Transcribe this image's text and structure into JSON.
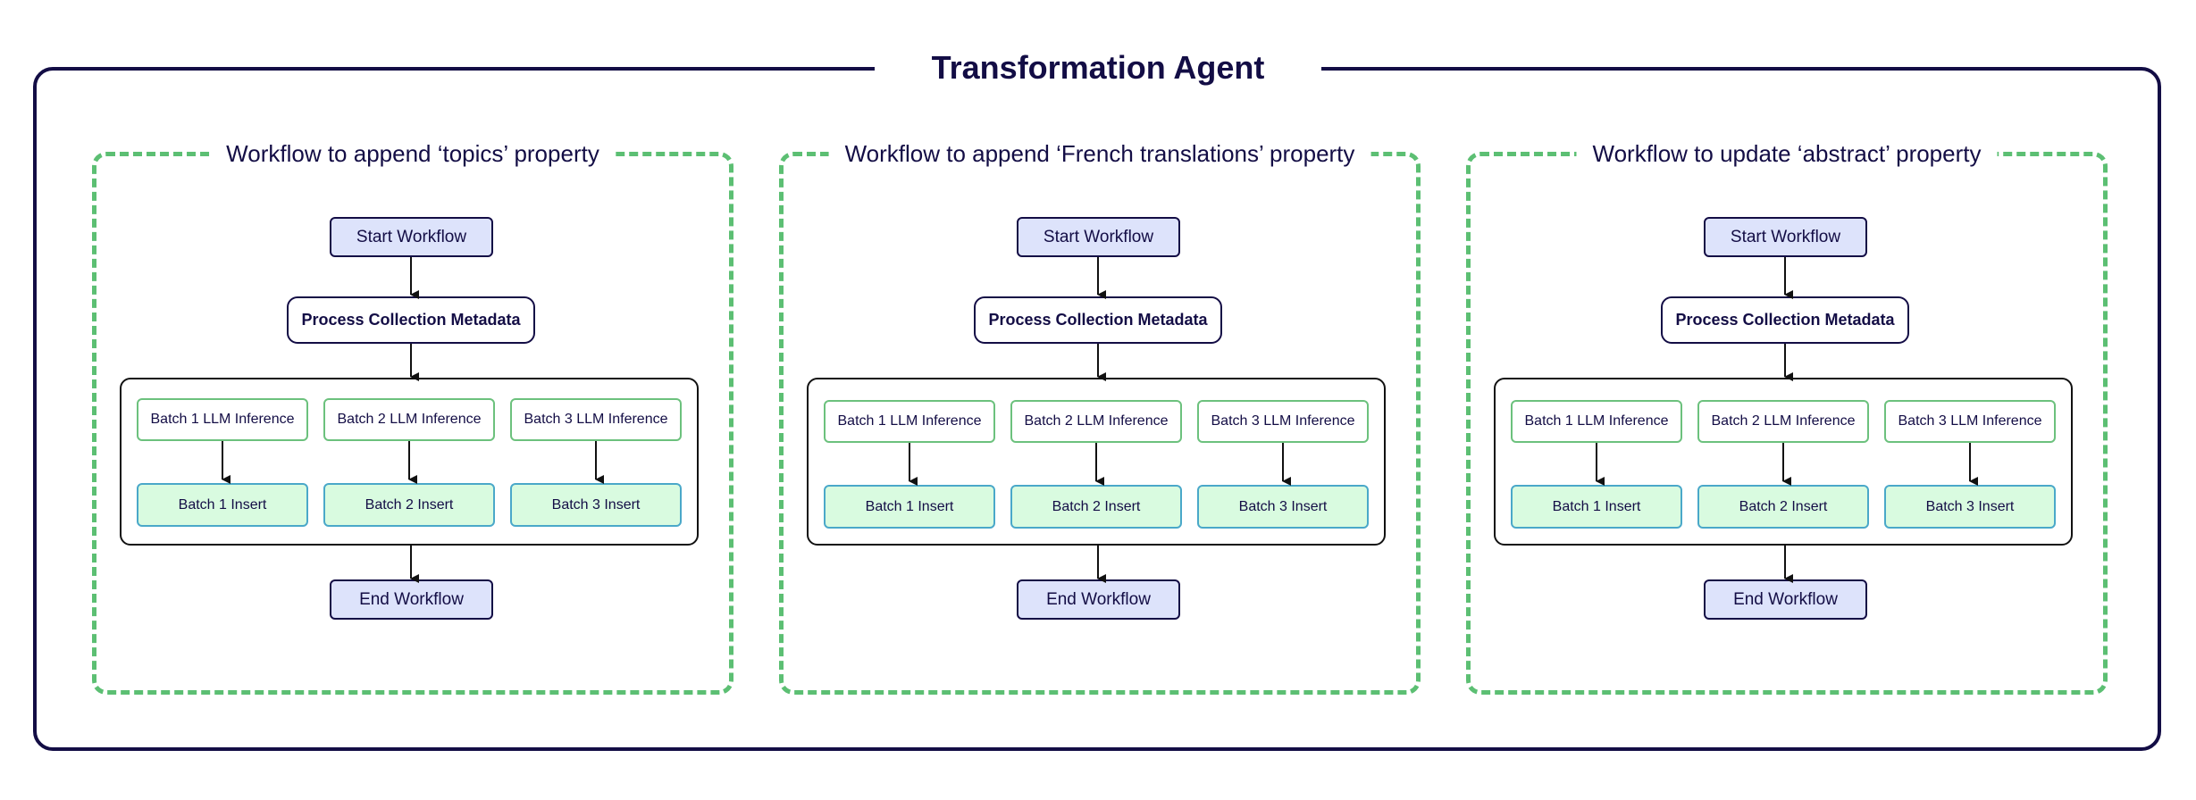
{
  "title": "Transformation Agent",
  "colors": {
    "navy": "#130d45",
    "dashed_green": "#5cbf73",
    "start_end_fill": "#dde3fb",
    "inference_border": "#6cc17d",
    "insert_fill": "#d9fbe0",
    "insert_border": "#4aa8c9"
  },
  "workflows": [
    {
      "title": "Workflow to append ‘topics’ property",
      "start": "Start Workflow",
      "process": "Process Collection Metadata",
      "batches": [
        {
          "inference": "Batch 1 LLM Inference",
          "insert": "Batch 1 Insert"
        },
        {
          "inference": "Batch 2 LLM Inference",
          "insert": "Batch 2 Insert"
        },
        {
          "inference": "Batch 3 LLM Inference",
          "insert": "Batch 3 Insert"
        }
      ],
      "end": "End Workflow"
    },
    {
      "title": "Workflow to append ‘French translations’ property",
      "start": "Start Workflow",
      "process": "Process Collection Metadata",
      "batches": [
        {
          "inference": "Batch 1 LLM Inference",
          "insert": "Batch 1 Insert"
        },
        {
          "inference": "Batch 2 LLM Inference",
          "insert": "Batch 2 Insert"
        },
        {
          "inference": "Batch 3 LLM Inference",
          "insert": "Batch 3 Insert"
        }
      ],
      "end": "End Workflow"
    },
    {
      "title": "Workflow to update ‘abstract’ property",
      "start": "Start Workflow",
      "process": "Process Collection Metadata",
      "batches": [
        {
          "inference": "Batch 1 LLM Inference",
          "insert": "Batch 1 Insert"
        },
        {
          "inference": "Batch 2 LLM Inference",
          "insert": "Batch 2 Insert"
        },
        {
          "inference": "Batch 3 LLM Inference",
          "insert": "Batch 3 Insert"
        }
      ],
      "end": "End Workflow"
    }
  ]
}
